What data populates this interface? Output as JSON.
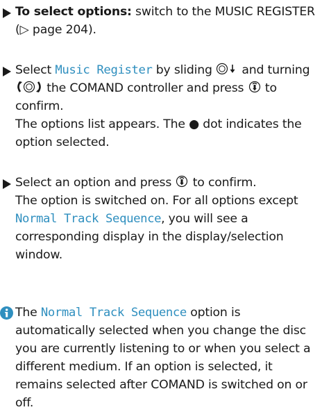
{
  "steps": [
    {
      "bold": "To select options:",
      "text": " switch to the MUSIC REGISTER (▷ page 204)."
    },
    {
      "before": "Select ",
      "ui": "Music Register",
      "middle1": " by sliding ",
      "middle2": " and turning ",
      "middle3": " the COMAND controller and press ",
      "after": " to confirm.",
      "result": "The options list appears. The ● dot indicates the option selected."
    },
    {
      "before": "Select an option and press ",
      "after": " to confirm.",
      "result_a": "The option is switched on. For all options except ",
      "ui": "Normal Track Sequence",
      "result_b": ", you will see a corresponding display in the display/selection window."
    }
  ],
  "info": {
    "before": "The ",
    "ui": "Normal Track Sequence",
    "after": " option is automatically selected when you change the disc you are currently listening to or when you select a different medium. If an option is selected, it remains selected after COMAND is switched on or off."
  },
  "colors": {
    "accent": "#2f8fbf",
    "text": "#1a1a1a"
  },
  "icons": [
    "step-arrow-icon",
    "controller-slide-down-icon",
    "controller-turn-icon",
    "controller-press-icon",
    "info-icon"
  ]
}
